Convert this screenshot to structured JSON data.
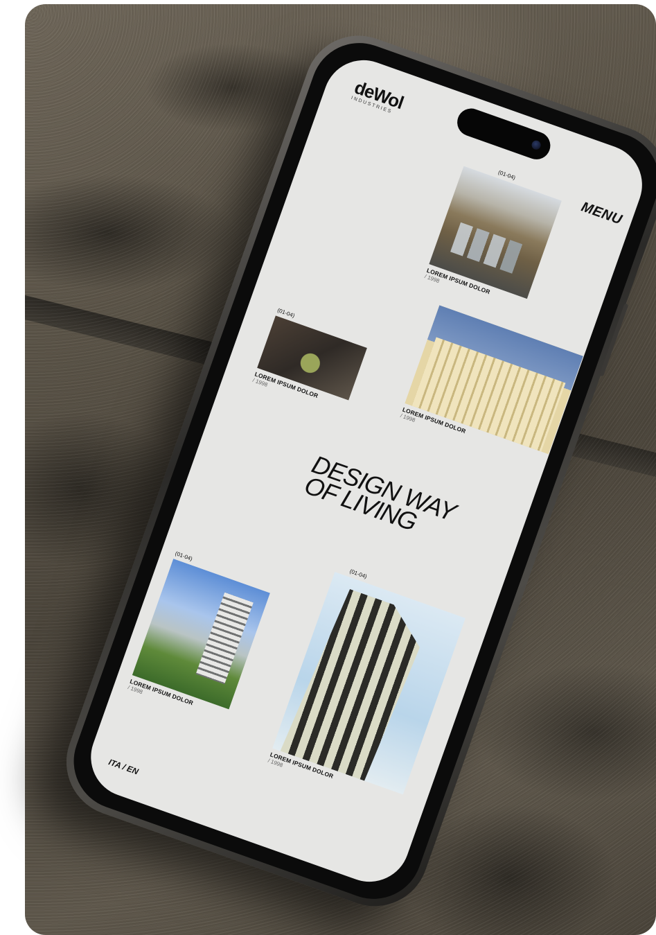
{
  "brand": {
    "name": "deWol",
    "subtitle": "INDUSTRIES"
  },
  "nav": {
    "menu_label": "MENU"
  },
  "hero": {
    "headline": "DESIGN WAY\nOF LIVING"
  },
  "language": {
    "label": "ITA / EN"
  },
  "cards": [
    {
      "index": "(01-04)",
      "title": "LOREM IPSUM DOLOR",
      "year": "/ 1998",
      "image": "aerial-industrial-park"
    },
    {
      "index": "(01-04)",
      "title": "LOREM IPSUM DOLOR",
      "year": "/ 1998",
      "image": "historic-palace-facade"
    },
    {
      "index": "(01-04)",
      "title": "LOREM IPSUM DOLOR",
      "year": "/ 1998",
      "image": "courtyard-aerial"
    },
    {
      "index": "(01-04)",
      "title": "LOREM IPSUM DOLOR",
      "year": "/ 1998",
      "image": "residential-garden-towers"
    },
    {
      "index": "(01-04)",
      "title": "LOREM IPSUM DOLOR",
      "year": "/ 1998",
      "image": "modern-tower-facade"
    }
  ]
}
